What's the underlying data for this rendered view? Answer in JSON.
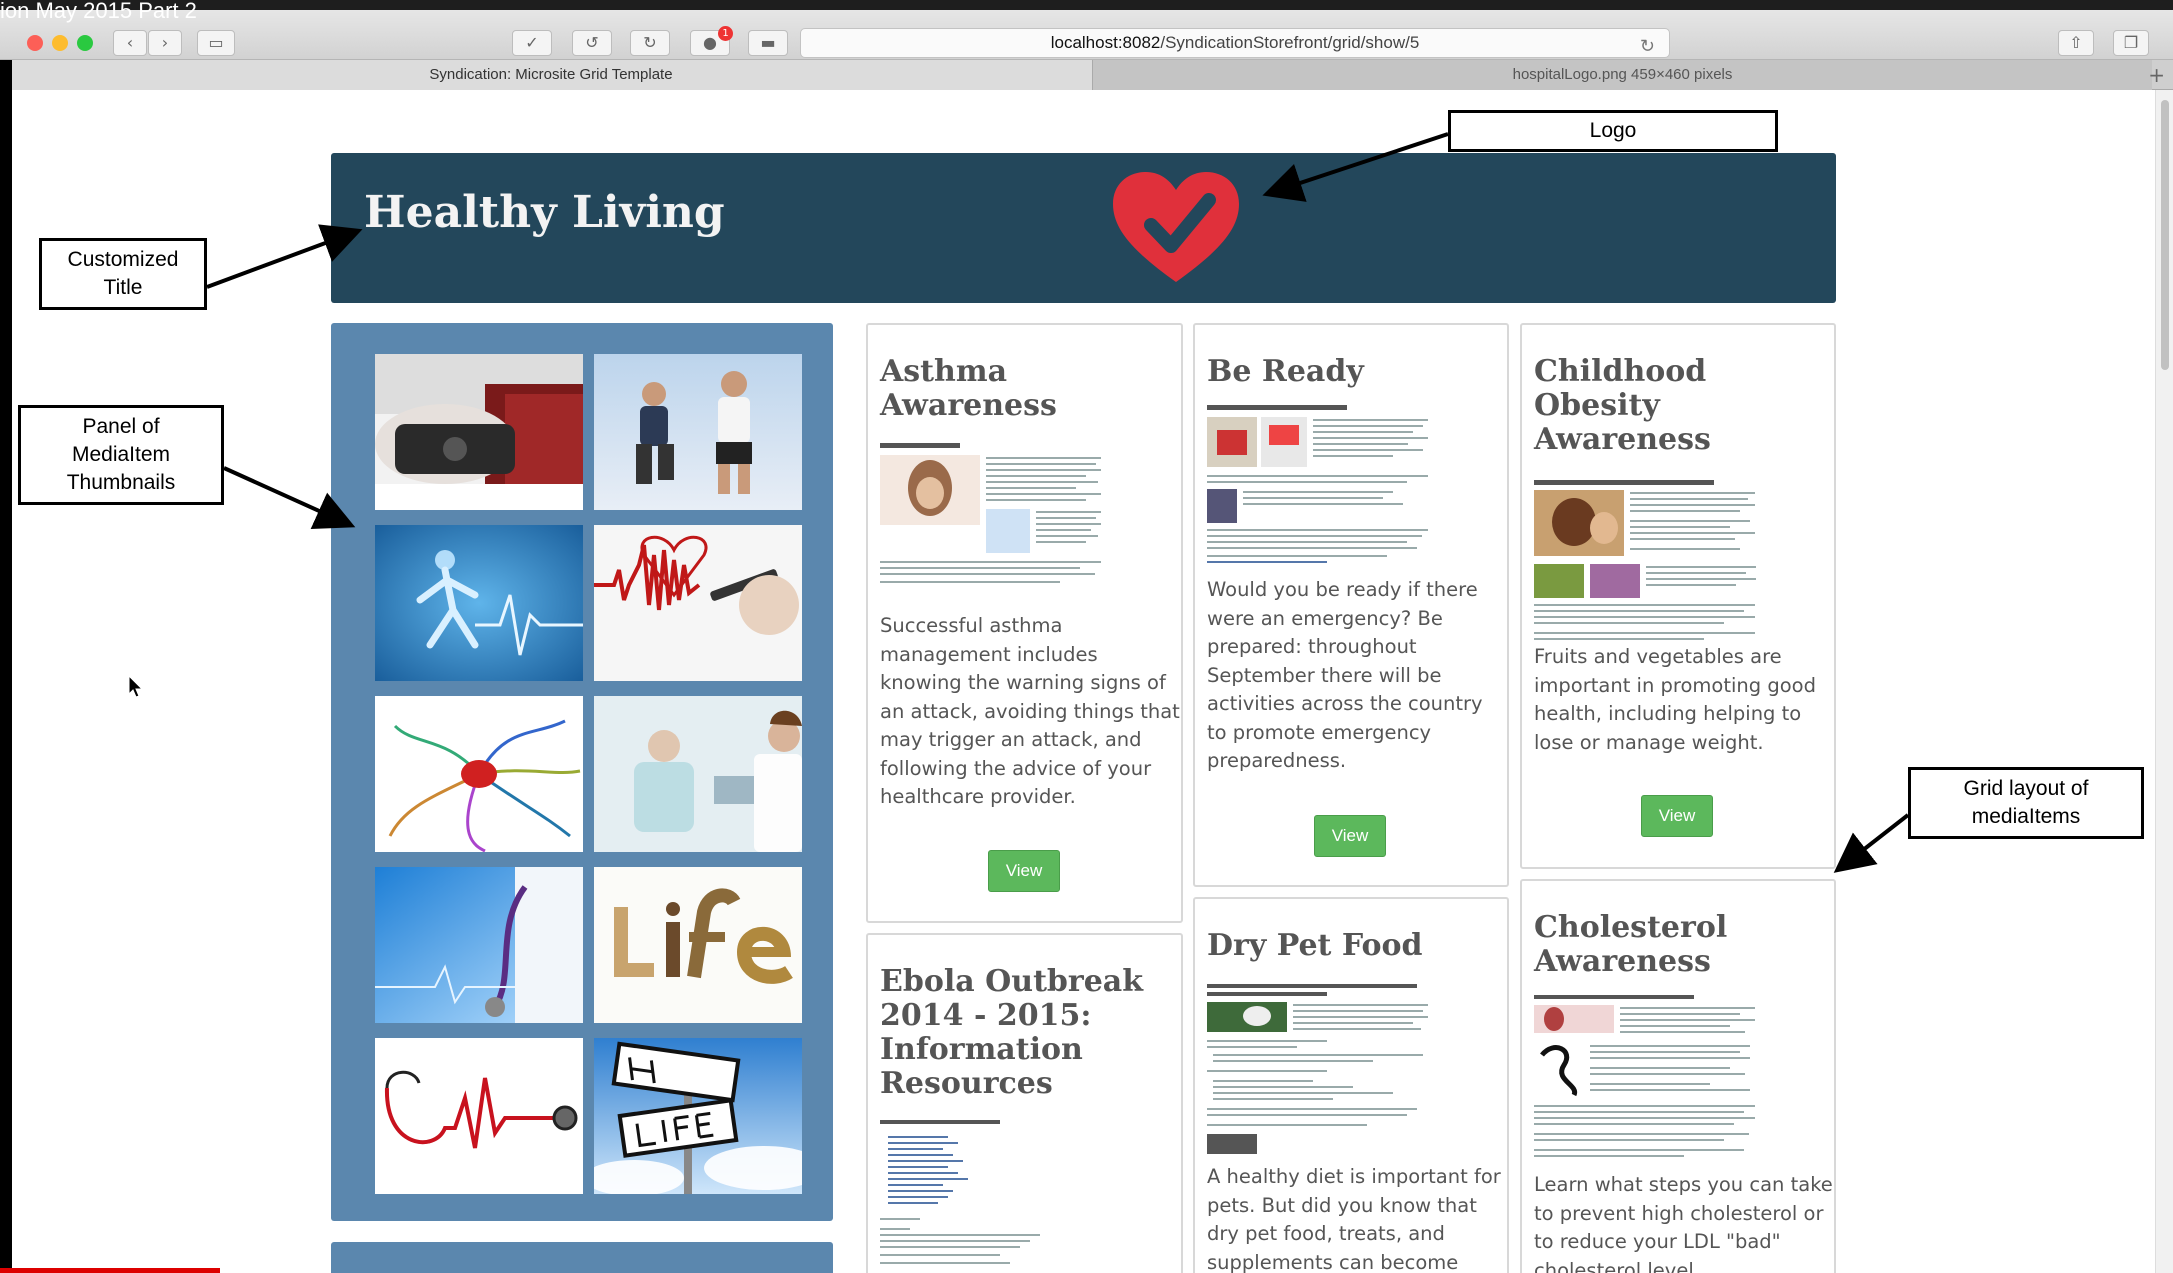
{
  "video_title": "ion May 2015 Part 2",
  "browser": {
    "url_host": "localhost:8082",
    "url_path": "/SyndicationStorefront/grid/show/5",
    "notification_count": "1",
    "tabs": [
      {
        "label": "Syndication: Microsite Grid Template"
      },
      {
        "label": "hospitalLogo.png 459×460 pixels"
      }
    ],
    "new_tab_icon": "+"
  },
  "page": {
    "header_title": "Healthy Living",
    "brand_color": "#23475b",
    "panel_color": "#5b87ae",
    "button_color": "#5cb85c"
  },
  "thumbnails": [
    {
      "subject": "blood-pressure-cuff"
    },
    {
      "subject": "jogging-couple"
    },
    {
      "subject": "running-xray-heartbeat"
    },
    {
      "subject": "heartbeat-drawing"
    },
    {
      "subject": "health-mind-map"
    },
    {
      "subject": "doctor-with-patient"
    },
    {
      "subject": "doctor-stethoscope"
    },
    {
      "subject": "life-word-food"
    },
    {
      "subject": "stethoscope-heartbeat"
    },
    {
      "subject": "healthy-life-sign"
    }
  ],
  "cards": [
    {
      "title": "Asthma Awareness",
      "description": "Successful asthma management includes knowing the warning signs of an attack, avoiding things that may trigger an attack, and following the advice of your healthcare provider.",
      "button": "View"
    },
    {
      "title": "Be Ready",
      "description": "Would you be ready if there were an emergency? Be prepared: throughout September there will be activities across the country to promote emergency preparedness.",
      "button": "View"
    },
    {
      "title": "Childhood Obesity Awareness",
      "description": "Fruits and vegetables are important in promoting good health, including helping to lose or manage weight.",
      "button": "View"
    },
    {
      "title": "Ebola Outbreak 2014 - 2015: Information Resources"
    },
    {
      "title": "Dry Pet Food",
      "description": "A healthy diet is important for pets. But did you know that dry pet food, treats, and supplements can become"
    },
    {
      "title": "Cholesterol Awareness",
      "description": "Learn what steps you can take to prevent high cholesterol or to reduce your LDL \"bad\" cholesterol level"
    }
  ],
  "annotations": {
    "logo": "Logo",
    "title_line1": "Customized",
    "title_line2": "Title",
    "panel_line1": "Panel of",
    "panel_line2": "MediaItem",
    "panel_line3": "Thumbnails",
    "grid_line1": "Grid layout of",
    "grid_line2": "mediaItems"
  }
}
